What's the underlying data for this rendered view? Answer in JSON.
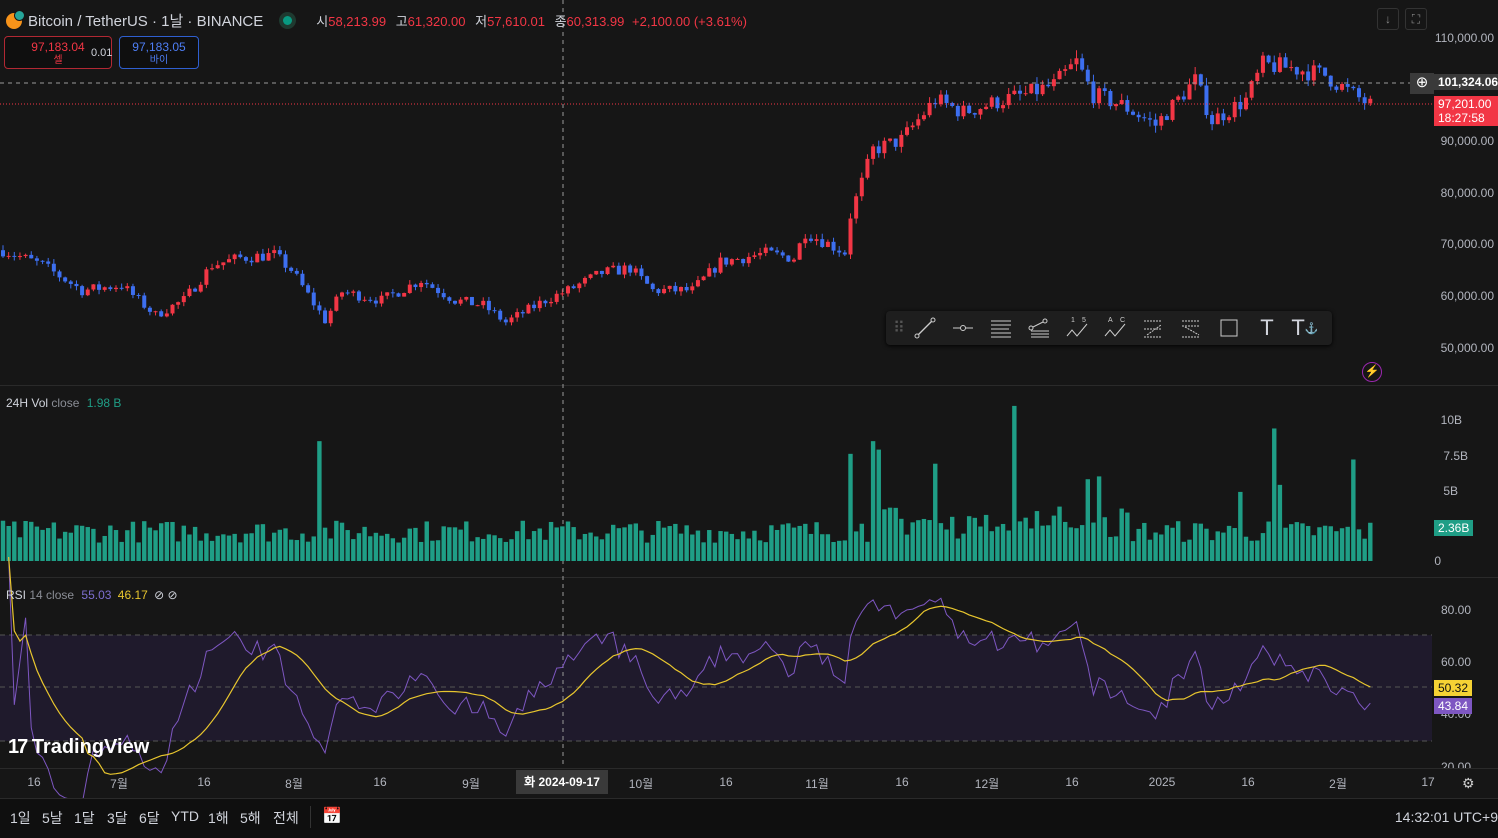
{
  "header": {
    "symbol": "Bitcoin / TetherUS · 1날 · BINANCE",
    "ohlc": [
      {
        "k": "시",
        "v": "58,213.99"
      },
      {
        "k": "고",
        "v": "61,320.00"
      },
      {
        "k": "저",
        "v": "57,610.01"
      },
      {
        "k": "종",
        "v": "60,313.99"
      }
    ],
    "change": "+2,100.00 (+3.61%)"
  },
  "trade": {
    "sell_price": "97,183.04",
    "sell_label": "셀",
    "spread": "0.01",
    "buy_price": "97,183.05",
    "buy_label": "바이"
  },
  "price_axis": {
    "ticks": [
      "110,000.00",
      "90,000.00",
      "80,000.00",
      "70,000.00",
      "60,000.00",
      "50,000.00"
    ],
    "crosshair_price": "101,324.06",
    "last_price": "97,201.00",
    "countdown": "18:27:58"
  },
  "volume": {
    "title": "24H Vol",
    "param": "close",
    "value": "1.98 B",
    "ticks": [
      "10B",
      "7.5B",
      "5B",
      "0"
    ],
    "last": "2.36B"
  },
  "rsi": {
    "title": "RSI",
    "param": "14 close",
    "value": "55.03",
    "ma_value": "46.17",
    "ticks": [
      "80.00",
      "60.00",
      "40.00",
      "20.00"
    ],
    "last_rsi": "43.84",
    "last_ma": "50.32"
  },
  "time_axis": {
    "labels": [
      "16",
      "7월",
      "16",
      "8월",
      "16",
      "9월",
      "10월",
      "16",
      "11월",
      "16",
      "12월",
      "16",
      "2025",
      "16",
      "2월",
      "17"
    ],
    "crosshair_date": "화 2024-09-17"
  },
  "ranges": [
    "1일",
    "5날",
    "1달",
    "3달",
    "6달",
    "YTD",
    "1해",
    "5해",
    "전체"
  ],
  "clock": "14:32:01 UTC+9",
  "logo": "TradingView",
  "colors": {
    "up": "#f23645",
    "down": "#3d6ff0",
    "vol": "#1f9e86",
    "rsi": "#7e57c2",
    "ma": "#e8c62e"
  },
  "chart_data": {
    "type": "candlestick",
    "days": 242,
    "price_path": [
      [
        0,
        68800
      ],
      [
        7,
        65900
      ],
      [
        14,
        61000
      ],
      [
        21,
        62000
      ],
      [
        27,
        56200
      ],
      [
        32,
        59100
      ],
      [
        37,
        65900
      ],
      [
        42,
        67300
      ],
      [
        48,
        67900
      ],
      [
        51,
        65000
      ],
      [
        57,
        55200
      ],
      [
        60,
        60700
      ],
      [
        67,
        59100
      ],
      [
        74,
        63000
      ],
      [
        80,
        59100
      ],
      [
        85,
        58100
      ],
      [
        89,
        54800
      ],
      [
        96,
        59100
      ],
      [
        100,
        61000
      ],
      [
        106,
        64400
      ],
      [
        111,
        65300
      ],
      [
        115,
        61000
      ],
      [
        122,
        61000
      ],
      [
        127,
        66500
      ],
      [
        135,
        68200
      ],
      [
        140,
        67300
      ],
      [
        142,
        72300
      ],
      [
        149,
        68400
      ],
      [
        150,
        75600
      ],
      [
        154,
        88300
      ],
      [
        159,
        90200
      ],
      [
        165,
        98000
      ],
      [
        170,
        95600
      ],
      [
        177,
        98000
      ],
      [
        181,
        99000
      ],
      [
        186,
        100900
      ],
      [
        190,
        105300
      ],
      [
        193,
        99000
      ],
      [
        198,
        97000
      ],
      [
        204,
        93100
      ],
      [
        211,
        101800
      ],
      [
        214,
        94000
      ],
      [
        220,
        98000
      ],
      [
        223,
        104800
      ],
      [
        228,
        104200
      ],
      [
        234,
        102800
      ],
      [
        239,
        99000
      ],
      [
        242,
        97000
      ]
    ],
    "volume_spikes": [
      [
        56,
        8.5
      ],
      [
        150,
        7.6
      ],
      [
        154,
        8.5
      ],
      [
        155,
        7.9
      ],
      [
        165,
        6.9
      ],
      [
        179,
        11
      ],
      [
        192,
        5.8
      ],
      [
        194,
        6
      ],
      [
        225,
        9.4
      ],
      [
        239,
        7.2
      ],
      [
        219,
        4.9
      ],
      [
        226,
        5.4
      ]
    ]
  }
}
